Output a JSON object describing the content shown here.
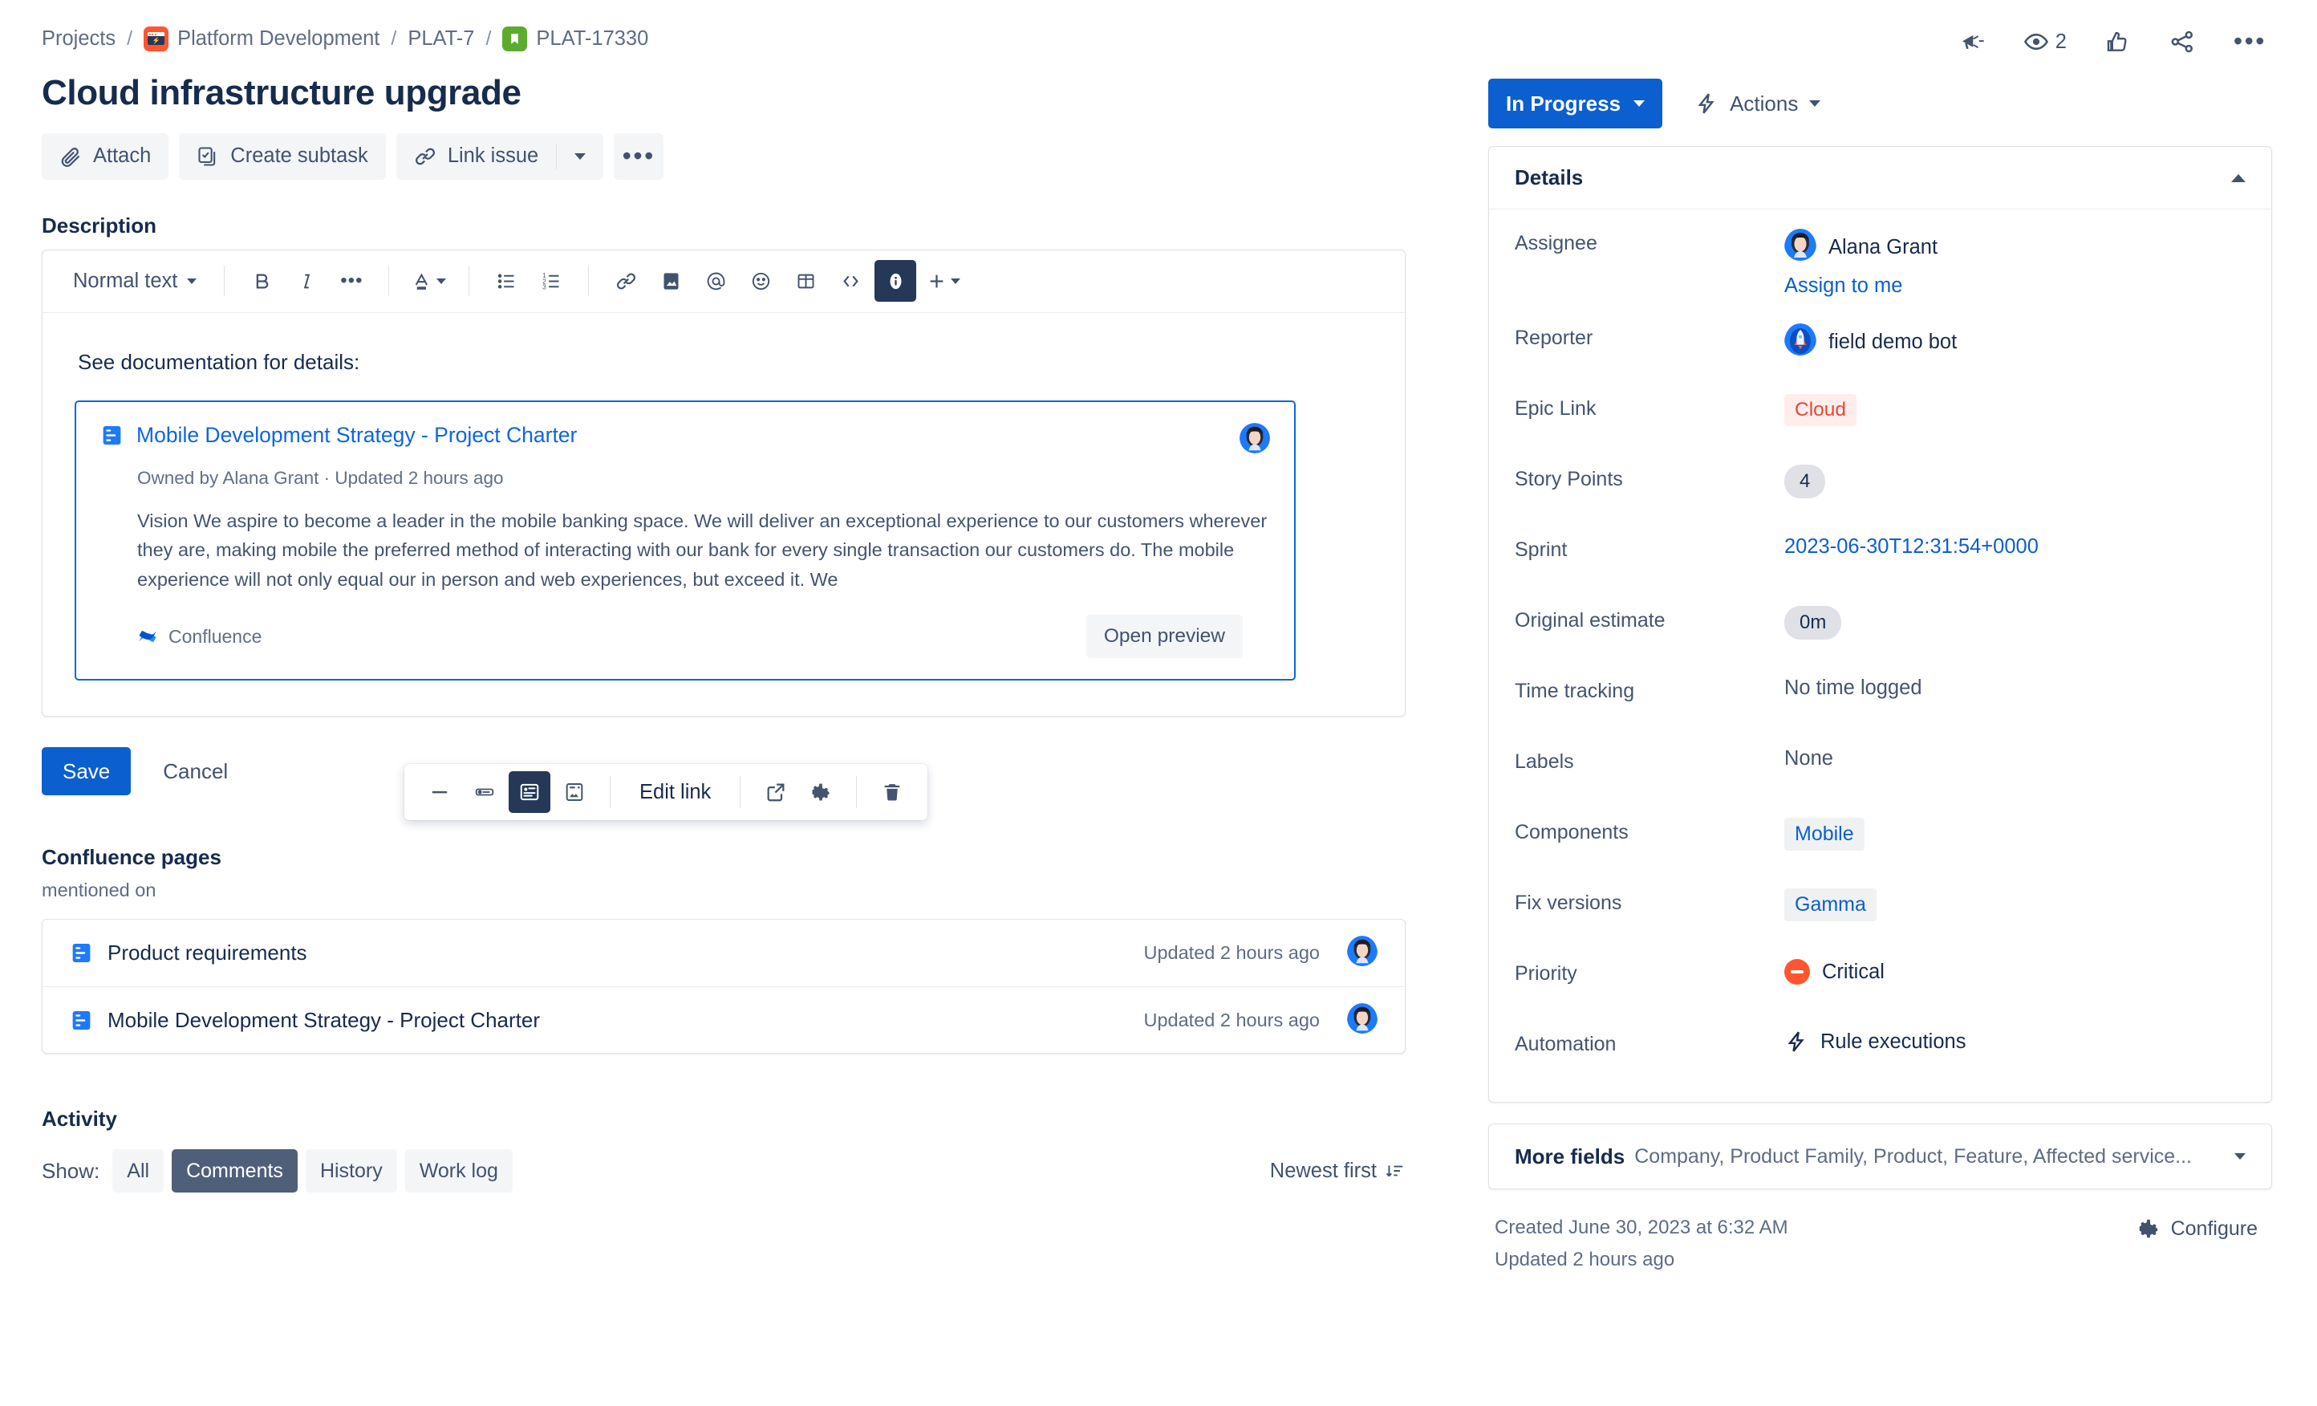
{
  "breadcrumb": {
    "projects": "Projects",
    "project_name": "Platform Development",
    "epic_key": "PLAT-7",
    "issue_key": "PLAT-17330"
  },
  "issue": {
    "title": "Cloud infrastructure upgrade"
  },
  "actions": {
    "attach": "Attach",
    "create_subtask": "Create subtask",
    "link_issue": "Link issue"
  },
  "description": {
    "label": "Description",
    "toolbar": {
      "block_type": "Normal text"
    },
    "intro_text": "See documentation for details:",
    "smart_card": {
      "title": "Mobile Development Strategy - Project Charter",
      "meta": "Owned by Alana Grant  ·  Updated 2 hours ago",
      "body": "Vision We aspire to become a leader in the mobile banking space. We will deliver an exceptional experience to our customers wherever they are, making mobile the preferred method of interacting with our bank for every single transaction our customers do. The mobile experience will not only equal our in person and web experiences, but exceed it. We",
      "provider": "Confluence",
      "open_preview": "Open preview"
    },
    "link_toolbar": {
      "edit_link": "Edit link"
    },
    "save": "Save",
    "cancel": "Cancel"
  },
  "confluence_pages": {
    "title": "Confluence pages",
    "subtitle": "mentioned on",
    "rows": [
      {
        "name": "Product requirements",
        "updated": "Updated 2 hours ago"
      },
      {
        "name": "Mobile Development Strategy - Project Charter",
        "updated": "Updated 2 hours ago"
      }
    ]
  },
  "activity": {
    "title": "Activity",
    "show_label": "Show:",
    "tabs": [
      {
        "label": "All",
        "active": false
      },
      {
        "label": "Comments",
        "active": true
      },
      {
        "label": "History",
        "active": false
      },
      {
        "label": "Work log",
        "active": false
      }
    ],
    "sort": "Newest first"
  },
  "top_icons": {
    "watch_count": "2"
  },
  "status": {
    "current": "In Progress",
    "actions_label": "Actions"
  },
  "details": {
    "header": "Details",
    "fields": {
      "assignee_label": "Assignee",
      "assignee_value": "Alana Grant",
      "assign_to_me": "Assign to me",
      "reporter_label": "Reporter",
      "reporter_value": "field demo bot",
      "epic_link_label": "Epic Link",
      "epic_link_value": "Cloud",
      "story_points_label": "Story Points",
      "story_points_value": "4",
      "sprint_label": "Sprint",
      "sprint_value": "2023-06-30T12:31:54+0000",
      "original_estimate_label": "Original estimate",
      "original_estimate_value": "0m",
      "time_tracking_label": "Time tracking",
      "time_tracking_value": "No time logged",
      "labels_label": "Labels",
      "labels_value": "None",
      "components_label": "Components",
      "components_value": "Mobile",
      "fix_versions_label": "Fix versions",
      "fix_versions_value": "Gamma",
      "priority_label": "Priority",
      "priority_value": "Critical",
      "automation_label": "Automation",
      "automation_value": "Rule executions"
    }
  },
  "more_fields": {
    "title": "More fields",
    "summary": "Company, Product Family, Product, Feature, Affected service..."
  },
  "footer": {
    "created": "Created June 30, 2023 at 6:32 AM",
    "updated": "Updated 2 hours ago",
    "configure": "Configure"
  },
  "colors": {
    "primary_blue": "#0C5FCE",
    "link_blue": "#0C66E4",
    "critical_red": "#FF5630",
    "epic_red": "#E34935",
    "story_green": "#5AAB2E",
    "project_orange": "#FF5630"
  }
}
